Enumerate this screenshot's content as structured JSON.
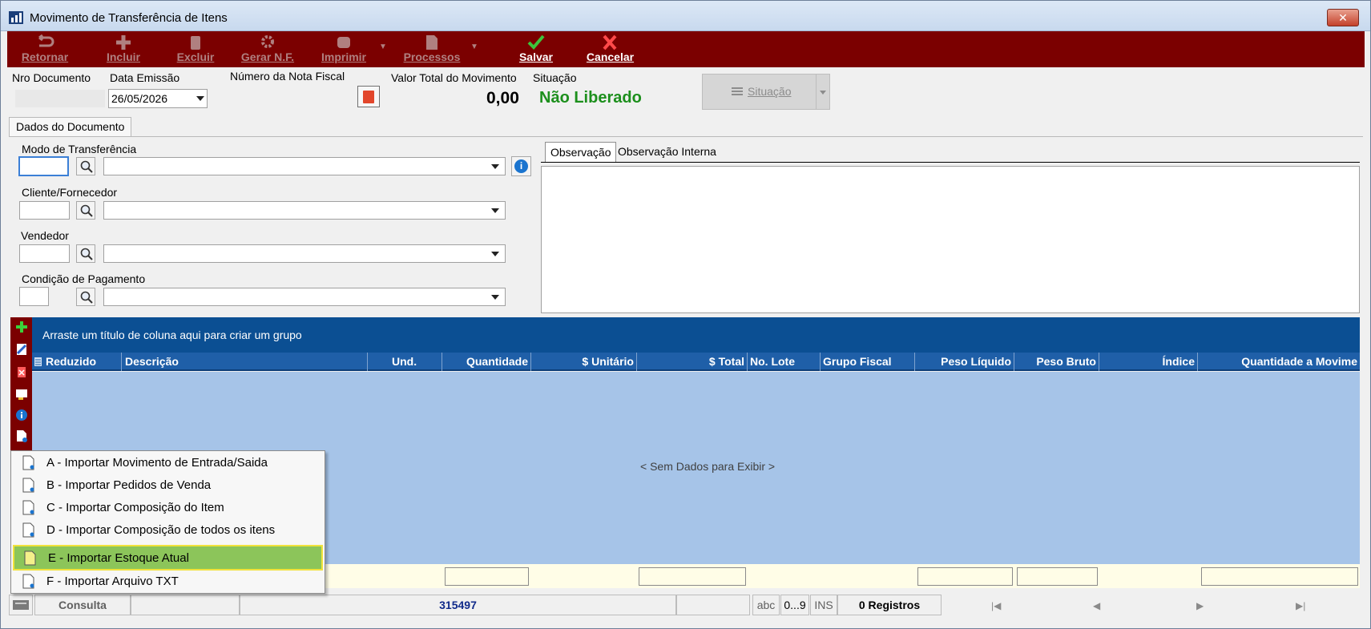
{
  "window": {
    "title": "Movimento de Transferência de Itens",
    "close_label": "✕"
  },
  "toolbar": {
    "items": [
      {
        "label": "Retornar",
        "icon": "return-icon"
      },
      {
        "label": "Incluir",
        "icon": "plus-icon"
      },
      {
        "label": "Excluir",
        "icon": "trash-icon"
      },
      {
        "label": "Gerar N.F.",
        "icon": "gear-icon"
      },
      {
        "label": "Imprimir",
        "icon": "printer-icon"
      },
      {
        "label": "Processos",
        "icon": "document-icon"
      },
      {
        "label": "Salvar",
        "icon": "check-icon"
      },
      {
        "label": "Cancelar",
        "icon": "x-icon"
      }
    ]
  },
  "header": {
    "nro_documento_label": "Nro Documento",
    "data_emissao_label": "Data Emissão",
    "data_emissao_value": "26/05/2026",
    "numero_nf_label": "Número da Nota Fiscal",
    "valor_total_label": "Valor Total do Movimento",
    "situacao_label": "Situação",
    "valor_total_value": "0,00",
    "situacao_value": "Não Liberado",
    "situacao_button": "Situação"
  },
  "tabs": {
    "dados_documento": "Dados do Documento"
  },
  "form": {
    "modo_label": "Modo de Transferência",
    "cliente_label": "Cliente/Fornecedor",
    "vendedor_label": "Vendedor",
    "condicao_label": "Condição de Pagamento",
    "info_glyph": "i"
  },
  "observacao": {
    "tab1": "Observação",
    "tab2": "Observação Interna"
  },
  "grid": {
    "group_hint": "Arraste um título de coluna aqui para criar um grupo",
    "columns": [
      "Reduzido",
      "Descrição",
      "Und.",
      "Quantidade",
      "$ Unitário",
      "$ Total",
      "No. Lote",
      "Grupo Fiscal",
      "Peso Líquido",
      "Peso Bruto",
      "Índice",
      "Quantidade a Movime"
    ],
    "empty_message": "< Sem Dados para Exibir >"
  },
  "statusbar": {
    "mode": "Consulta",
    "code": "315497",
    "abc": "abc",
    "digits": "0...9",
    "ins": "INS",
    "records": "0 Registros"
  },
  "menu": {
    "items": [
      "A - Importar Movimento de Entrada/Saida",
      "B - Importar Pedidos de Venda",
      "C - Importar Composição do Item",
      "D - Importar Composição de todos os itens",
      "E - Importar Estoque Atual",
      "F - Importar Arquivo TXT"
    ],
    "highlighted_index": 4
  },
  "colors": {
    "toolbar_bg": "#7b0000",
    "grid_group_bg": "#0b4f93",
    "grid_header_bg": "#1f5fa8",
    "grid_body_bg": "#a6c4e8",
    "status_green": "#1c8f1c",
    "menu_highlight": "#8cc55a"
  }
}
